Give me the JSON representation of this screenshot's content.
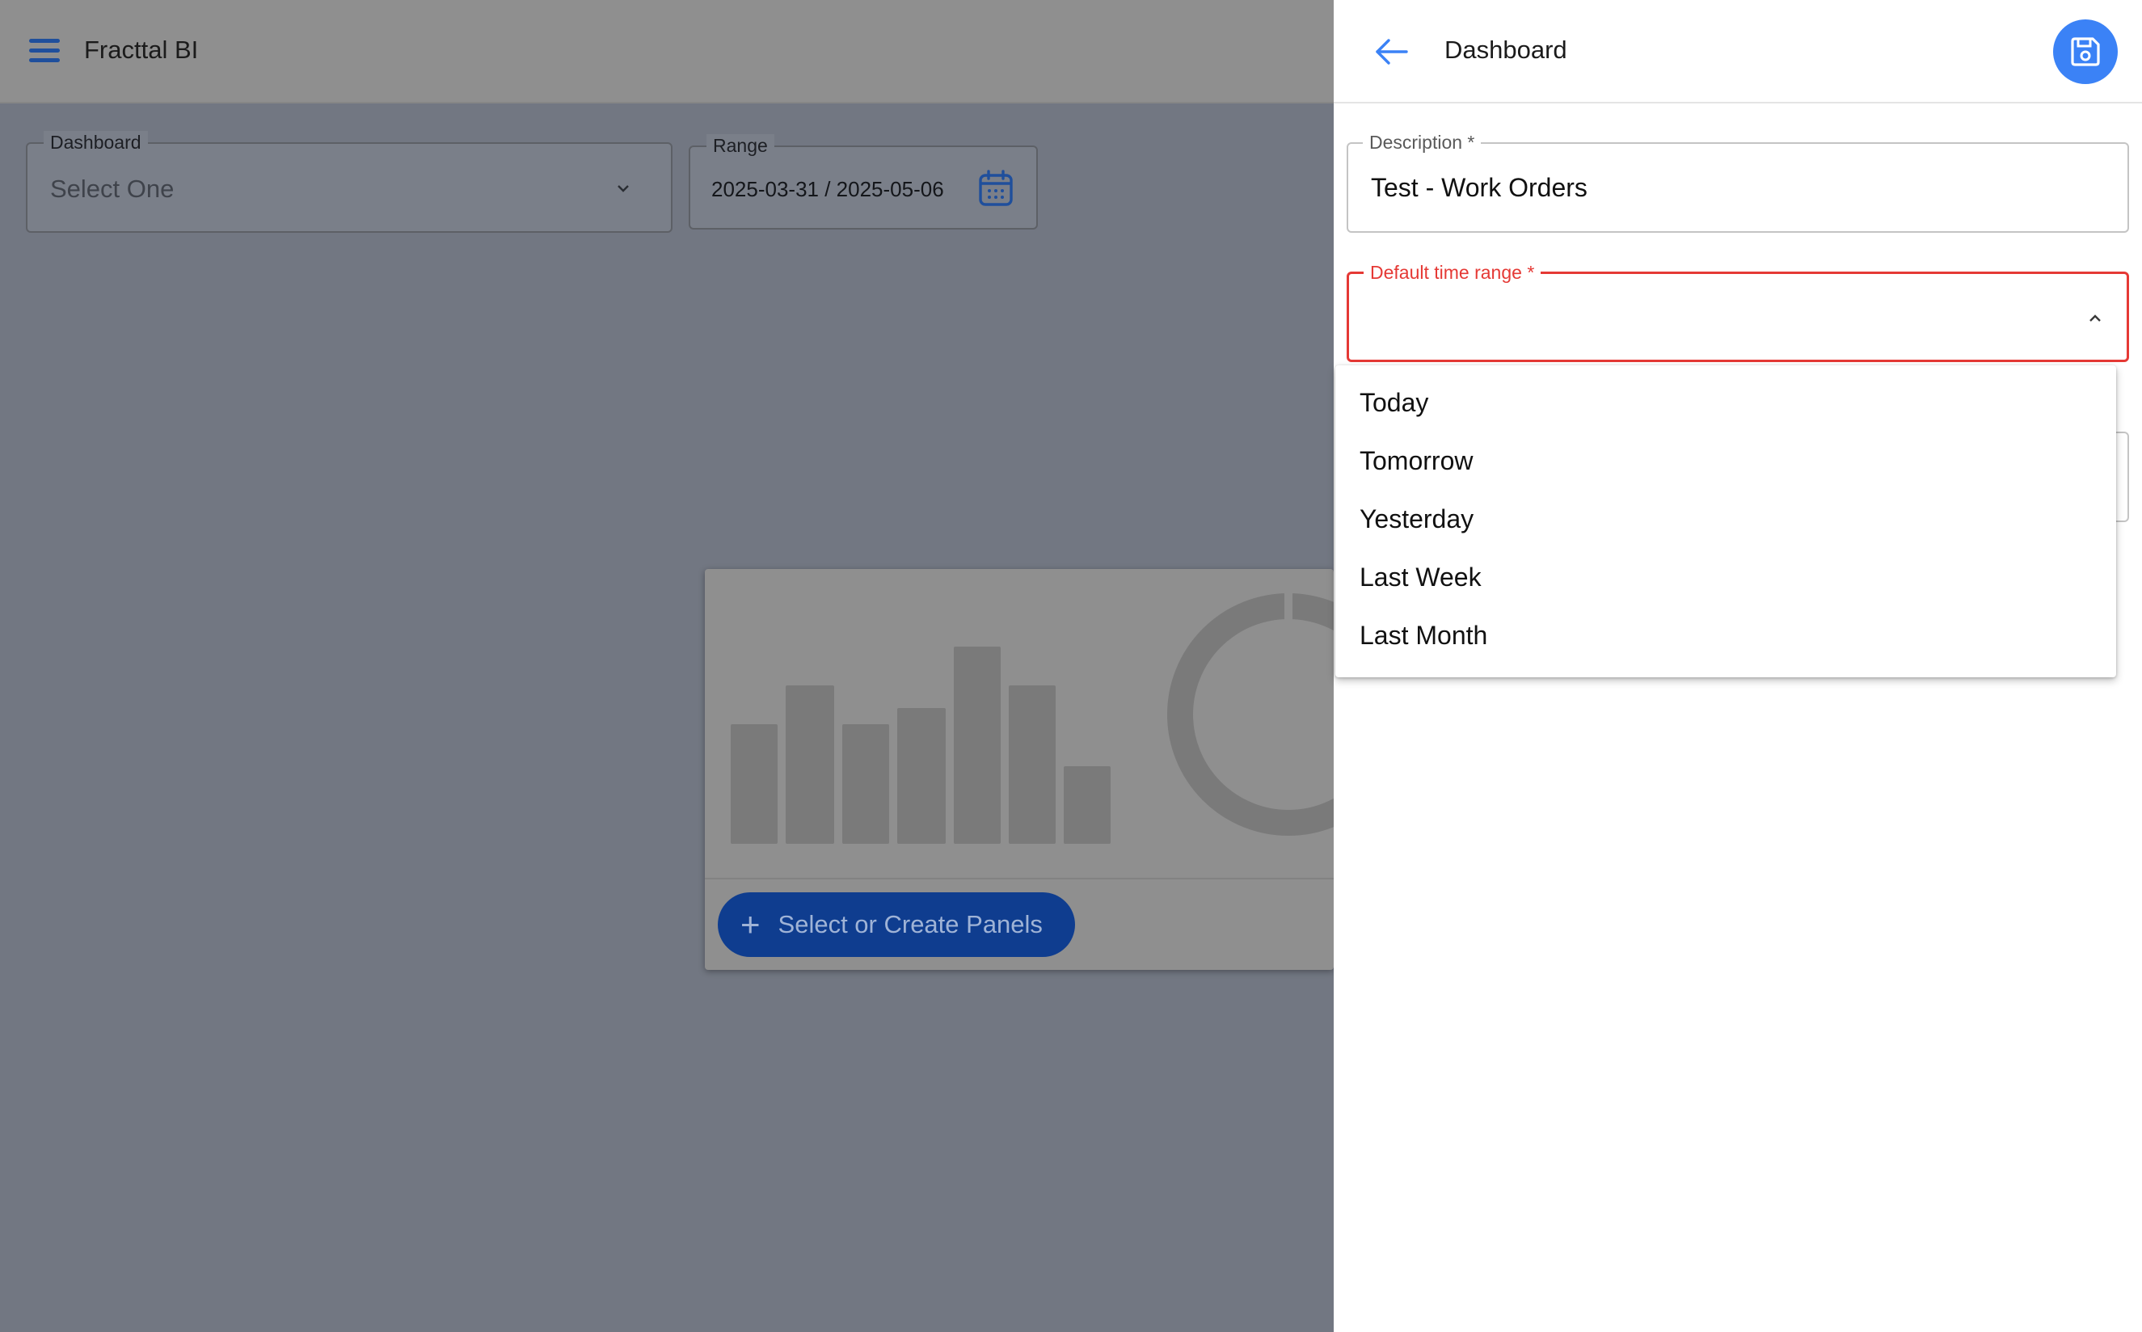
{
  "app": {
    "title": "Fracttal BI"
  },
  "filters": {
    "dashboard": {
      "label": "Dashboard",
      "placeholder": "Select One"
    },
    "range": {
      "label": "Range",
      "value": "2025-03-31 / 2025-05-06"
    }
  },
  "panel": {
    "create_button_label": "Select or Create Panels"
  },
  "side_panel": {
    "title": "Dashboard",
    "description": {
      "label": "Description *",
      "value": "Test - Work Orders"
    },
    "default_time_range": {
      "label": "Default time range *",
      "options": [
        "Today",
        "Tomorrow",
        "Yesterday",
        "Last Week",
        "Last Month"
      ]
    }
  },
  "colors": {
    "accent": "#3b82f6",
    "error": "#e53935",
    "overlay_dark_blue": "#0f3d8f"
  },
  "icons": [
    "menu-icon",
    "chevron-down-icon",
    "calendar-icon",
    "plus-icon",
    "back-arrow-icon",
    "save-icon",
    "chevron-up-icon"
  ]
}
